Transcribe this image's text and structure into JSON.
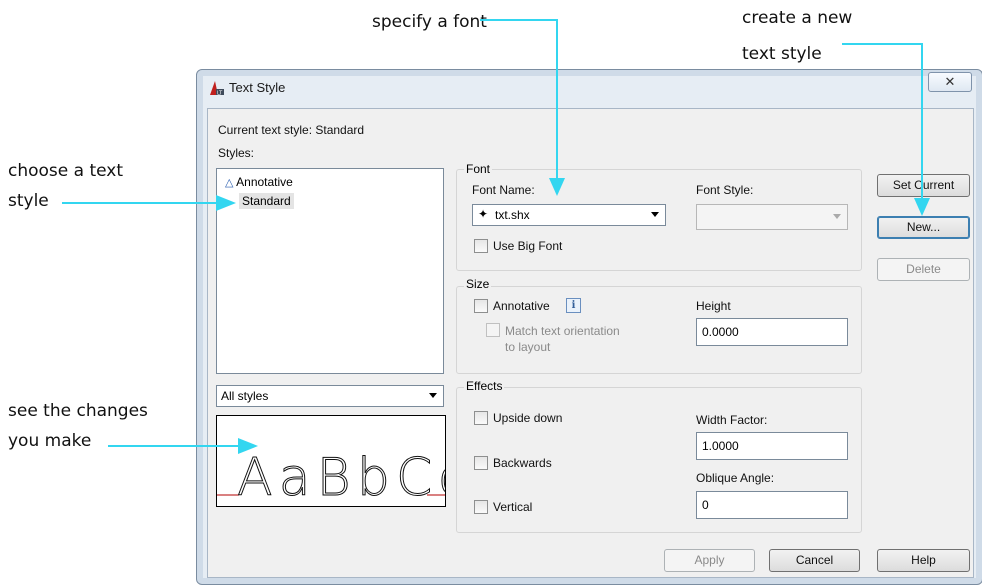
{
  "callouts": {
    "specify_font": "specify a font",
    "new_style_line1": "create a new",
    "new_style_line2": "text style",
    "choose_style_line1": "choose a text",
    "choose_style_line2": "style",
    "see_changes_line1": "see the changes",
    "see_changes_line2": "you make"
  },
  "dialog": {
    "title": "Text Style",
    "close_glyph": "✕",
    "current_style_label": "Current text style:  Standard",
    "styles_label": "Styles:",
    "styles": [
      "Annotative",
      "Standard"
    ],
    "selected_style": "Standard",
    "filter_value": "All styles",
    "preview_text": "AaBbCc",
    "font": {
      "group_label": "Font",
      "font_name_label": "Font Name:",
      "font_name_value": "txt.shx",
      "font_style_label": "Font Style:",
      "font_style_value": "",
      "use_big_font_label": "Use Big Font"
    },
    "size": {
      "group_label": "Size",
      "annotative_label": "Annotative",
      "info_glyph": "i",
      "match_orientation_line1": "Match text orientation",
      "match_orientation_line2": "to layout",
      "height_label": "Height",
      "height_value": "0.0000"
    },
    "effects": {
      "group_label": "Effects",
      "upside_down_label": "Upside down",
      "backwards_label": "Backwards",
      "vertical_label": "Vertical",
      "width_factor_label": "Width Factor:",
      "width_factor_value": "1.0000",
      "oblique_angle_label": "Oblique Angle:",
      "oblique_angle_value": "0"
    },
    "buttons": {
      "set_current": "Set Current",
      "new": "New...",
      "delete": "Delete",
      "apply": "Apply",
      "cancel": "Cancel",
      "help": "Help"
    }
  },
  "colors": {
    "callout_line": "#33d6f0",
    "preview_baseline": "#b30000"
  }
}
